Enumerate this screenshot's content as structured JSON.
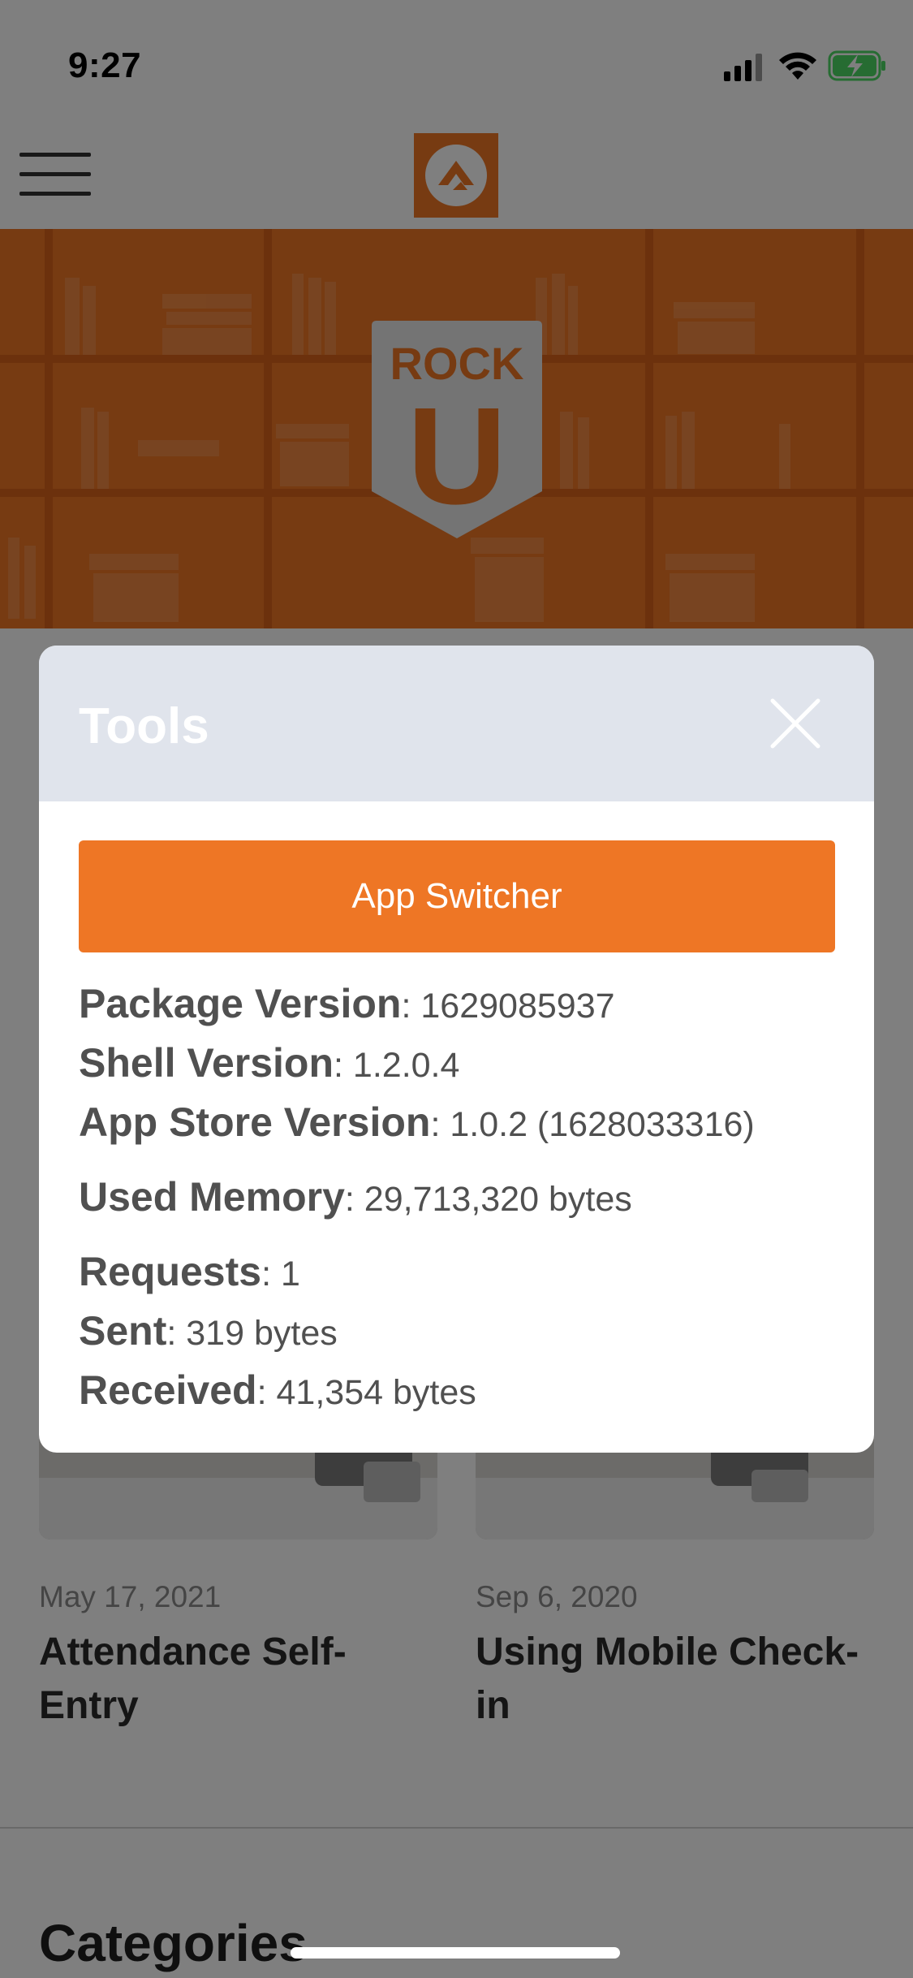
{
  "status_bar": {
    "time": "9:27",
    "icons": [
      "signal-icon",
      "wifi-icon",
      "battery-charging-icon"
    ]
  },
  "nav": {
    "menu_icon": "hamburger-menu-icon",
    "logo_icon": "rock-logo-icon"
  },
  "hero": {
    "badge_top": "ROCK",
    "badge_letter": "U"
  },
  "cards": [
    {
      "date": "May 17, 2021",
      "title": "Attendance Self-Entry"
    },
    {
      "date": "Sep 6, 2020",
      "title": "Using Mobile Check-in"
    }
  ],
  "categories_heading": "Categories",
  "modal": {
    "title": "Tools",
    "close_icon": "close-icon",
    "app_switcher_label": "App Switcher",
    "info": [
      {
        "key": "Package Version",
        "value": "1629085937"
      },
      {
        "key": "Shell Version",
        "value": "1.2.0.4"
      },
      {
        "key": "App Store Version",
        "value": "1.0.2 (1628033316)"
      },
      {
        "key": "Used Memory",
        "value": "29,713,320 bytes"
      },
      {
        "key": "Requests",
        "value": "1"
      },
      {
        "key": "Sent",
        "value": "319 bytes"
      },
      {
        "key": "Received",
        "value": "41,354 bytes"
      }
    ]
  },
  "colors": {
    "brand_orange": "#ee7625",
    "modal_header": "#e0e4ec",
    "overlay": "rgba(0,0,0,0.5)"
  }
}
